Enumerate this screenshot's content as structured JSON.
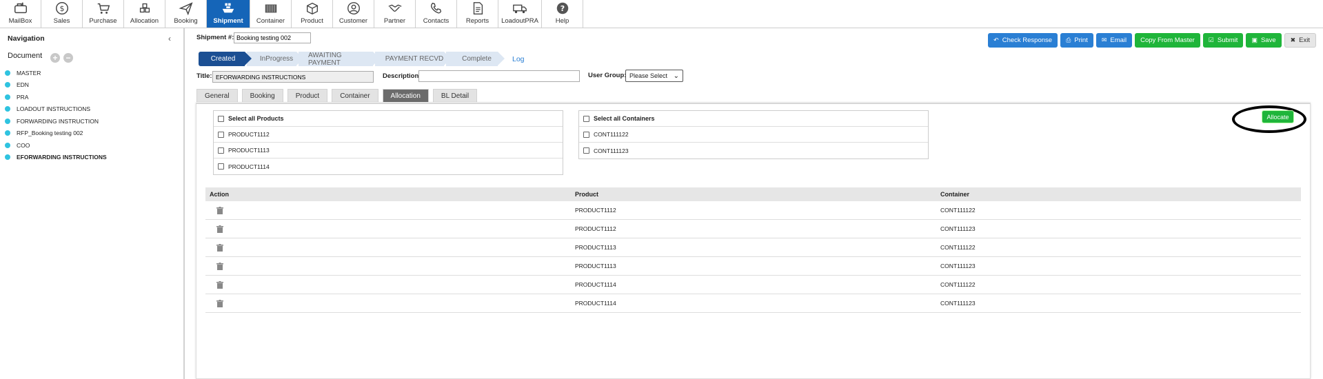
{
  "topnav": [
    {
      "label": "MailBox",
      "icon": "mailbox-icon"
    },
    {
      "label": "Sales",
      "icon": "dollar-icon"
    },
    {
      "label": "Purchase",
      "icon": "cart-icon"
    },
    {
      "label": "Allocation",
      "icon": "allocation-icon"
    },
    {
      "label": "Booking",
      "icon": "paper-plane-icon"
    },
    {
      "label": "Shipment",
      "icon": "ship-icon",
      "active": true
    },
    {
      "label": "Container",
      "icon": "container-icon"
    },
    {
      "label": "Product",
      "icon": "box-icon"
    },
    {
      "label": "Customer",
      "icon": "user-circle-icon"
    },
    {
      "label": "Partner",
      "icon": "handshake-icon"
    },
    {
      "label": "Contacts",
      "icon": "phone-icon"
    },
    {
      "label": "Reports",
      "icon": "report-icon"
    },
    {
      "label": "LoadoutPRA",
      "icon": "truck-icon"
    },
    {
      "label": "Help",
      "icon": "help-icon"
    }
  ],
  "sidebar": {
    "title": "Navigation",
    "collapse": "‹",
    "doc_label": "Document",
    "items": [
      {
        "label": "MASTER"
      },
      {
        "label": "EDN"
      },
      {
        "label": "PRA"
      },
      {
        "label": "LOADOUT INSTRUCTIONS"
      },
      {
        "label": "FORWARDING INSTRUCTION"
      },
      {
        "label": "RFP_Booking testing 002"
      },
      {
        "label": "COO"
      },
      {
        "label": "EFORWARDING INSTRUCTIONS",
        "selected": true
      }
    ]
  },
  "header": {
    "shipment_label": "Shipment #:",
    "shipment_value": "Booking testing 002"
  },
  "actions": {
    "check_response": "Check Response",
    "print": "Print",
    "email": "Email",
    "copy_from_master": "Copy From Master",
    "submit": "Submit",
    "save": "Save",
    "exit": "Exit"
  },
  "steps": [
    "Created",
    "InProgress",
    "AWAITING PAYMENT",
    "PAYMENT RECVD",
    "Complete"
  ],
  "log_label": "Log",
  "fields": {
    "title_label": "Title:",
    "title_value": "EFORWARDING INSTRUCTIONS",
    "description_label": "Description:",
    "description_value": "",
    "user_group_label": "User Group:",
    "user_group_value": "Please Select"
  },
  "tabs": [
    "General",
    "Booking",
    "Product",
    "Container",
    "Allocation",
    "BL Detail"
  ],
  "active_tab": "Allocation",
  "products_box": {
    "select_all": "Select all Products",
    "items": [
      "PRODUCT1112",
      "PRODUCT1113",
      "PRODUCT1114"
    ]
  },
  "containers_box": {
    "select_all": "Select all Containers",
    "items": [
      "CONT111122",
      "CONT111123"
    ]
  },
  "allocate_label": "Allocate",
  "table": {
    "headers": [
      "Action",
      "Product",
      "Container"
    ],
    "rows": [
      {
        "product": "PRODUCT1112",
        "container": "CONT111122"
      },
      {
        "product": "PRODUCT1112",
        "container": "CONT111123"
      },
      {
        "product": "PRODUCT1113",
        "container": "CONT111122"
      },
      {
        "product": "PRODUCT1113",
        "container": "CONT111123"
      },
      {
        "product": "PRODUCT1114",
        "container": "CONT111122"
      },
      {
        "product": "PRODUCT1114",
        "container": "CONT111123"
      }
    ]
  },
  "colors": {
    "active_nav": "#1565b8",
    "step_active": "#1b4f93",
    "button_blue": "#2a7fd4",
    "button_green": "#1fb53a",
    "nav_dot": "#2fc3e0"
  }
}
